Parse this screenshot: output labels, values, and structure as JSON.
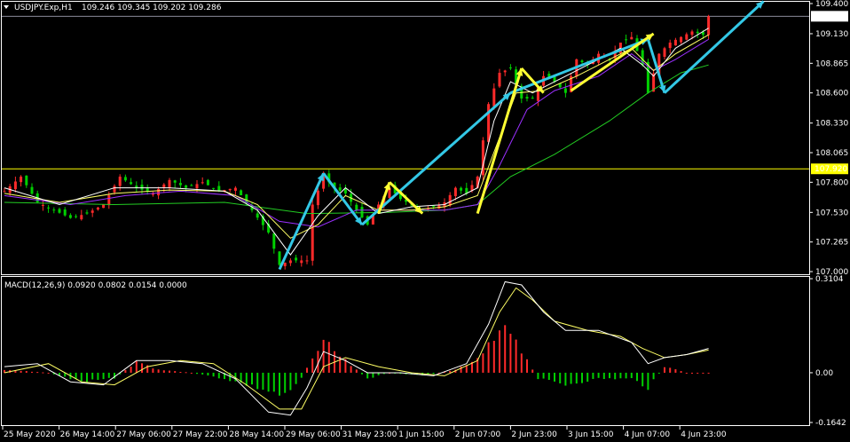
{
  "chart_data": [
    {
      "type": "candlestick",
      "title": "USDJPY.Exp,H1",
      "ohlc_label": "109.246 109.345 109.202 109.286",
      "ylim": [
        107.0,
        109.4
      ],
      "y_ticks": [
        "109.400",
        "109.130",
        "108.865",
        "108.600",
        "108.330",
        "108.065",
        "107.800",
        "107.530",
        "107.265",
        "107.000"
      ],
      "y_tick_values": [
        109.4,
        109.13,
        108.865,
        108.6,
        108.33,
        108.065,
        107.8,
        107.53,
        107.265,
        107.0
      ],
      "price_label": "109.286",
      "price_value": 109.286,
      "hline_label": "107.920",
      "hline_value": 107.92,
      "colors": {
        "up": "#ff2a2a",
        "down": "#00d000",
        "ma_fast": "#ffffff",
        "ma_mid": "#ffff66",
        "ma_slow": "#9b30ff",
        "ma_long": "#22cc22",
        "hline": "#ffff00",
        "arrow_yellow": "#ffff33",
        "arrow_cyan": "#33c8e6"
      },
      "price_path": [
        [
          0,
          107.72
        ],
        [
          3,
          107.85
        ],
        [
          6,
          107.62
        ],
        [
          9,
          107.55
        ],
        [
          12,
          107.48
        ],
        [
          15,
          107.52
        ],
        [
          18,
          107.6
        ],
        [
          21,
          107.85
        ],
        [
          24,
          107.75
        ],
        [
          27,
          107.7
        ],
        [
          30,
          107.82
        ],
        [
          33,
          107.75
        ],
        [
          36,
          107.8
        ],
        [
          39,
          107.72
        ],
        [
          42,
          107.75
        ],
        [
          45,
          107.55
        ],
        [
          48,
          107.35
        ],
        [
          50,
          107.06
        ],
        [
          52,
          107.1
        ],
        [
          55,
          107.1
        ],
        [
          56,
          107.6
        ],
        [
          58,
          107.85
        ],
        [
          60,
          107.75
        ],
        [
          62,
          107.7
        ],
        [
          64,
          107.55
        ],
        [
          66,
          107.42
        ],
        [
          68,
          107.6
        ],
        [
          70,
          107.75
        ],
        [
          72,
          107.65
        ],
        [
          74,
          107.6
        ],
        [
          76,
          107.55
        ],
        [
          78,
          107.58
        ],
        [
          80,
          107.62
        ],
        [
          82,
          107.75
        ],
        [
          84,
          107.7
        ],
        [
          86,
          107.85
        ],
        [
          88,
          108.5
        ],
        [
          90,
          108.78
        ],
        [
          92,
          108.82
        ],
        [
          94,
          108.55
        ],
        [
          96,
          108.55
        ],
        [
          98,
          108.75
        ],
        [
          100,
          108.7
        ],
        [
          102,
          108.6
        ],
        [
          104,
          108.9
        ],
        [
          106,
          108.85
        ],
        [
          108,
          108.95
        ],
        [
          110,
          108.9
        ],
        [
          112,
          109.05
        ],
        [
          114,
          109.1
        ],
        [
          116,
          108.85
        ],
        [
          117,
          108.6
        ],
        [
          119,
          108.95
        ],
        [
          121,
          109.05
        ],
        [
          123,
          109.1
        ],
        [
          125,
          109.15
        ],
        [
          127,
          109.12
        ],
        [
          128,
          109.286
        ]
      ],
      "ma_fast_path": [
        [
          0,
          107.75
        ],
        [
          10,
          107.6
        ],
        [
          20,
          107.75
        ],
        [
          30,
          107.75
        ],
        [
          40,
          107.72
        ],
        [
          46,
          107.55
        ],
        [
          52,
          107.15
        ],
        [
          57,
          107.5
        ],
        [
          62,
          107.75
        ],
        [
          68,
          107.52
        ],
        [
          74,
          107.58
        ],
        [
          80,
          107.6
        ],
        [
          86,
          107.75
        ],
        [
          89,
          108.35
        ],
        [
          92,
          108.7
        ],
        [
          96,
          108.6
        ],
        [
          100,
          108.7
        ],
        [
          106,
          108.85
        ],
        [
          112,
          109.0
        ],
        [
          116,
          108.85
        ],
        [
          118,
          108.75
        ],
        [
          122,
          109.0
        ],
        [
          128,
          109.18
        ]
      ],
      "ma_mid_path": [
        [
          0,
          107.7
        ],
        [
          10,
          107.62
        ],
        [
          20,
          107.7
        ],
        [
          30,
          107.73
        ],
        [
          40,
          107.72
        ],
        [
          46,
          107.6
        ],
        [
          52,
          107.3
        ],
        [
          57,
          107.42
        ],
        [
          62,
          107.68
        ],
        [
          68,
          107.55
        ],
        [
          74,
          107.55
        ],
        [
          80,
          107.58
        ],
        [
          86,
          107.68
        ],
        [
          90,
          108.2
        ],
        [
          93,
          108.6
        ],
        [
          98,
          108.62
        ],
        [
          104,
          108.75
        ],
        [
          110,
          108.9
        ],
        [
          114,
          109.0
        ],
        [
          118,
          108.8
        ],
        [
          122,
          108.95
        ],
        [
          128,
          109.12
        ]
      ],
      "ma_slow_path": [
        [
          0,
          107.68
        ],
        [
          12,
          107.6
        ],
        [
          22,
          107.68
        ],
        [
          32,
          107.72
        ],
        [
          42,
          107.68
        ],
        [
          50,
          107.45
        ],
        [
          57,
          107.4
        ],
        [
          64,
          107.55
        ],
        [
          72,
          107.55
        ],
        [
          80,
          107.55
        ],
        [
          86,
          107.6
        ],
        [
          90,
          107.95
        ],
        [
          95,
          108.45
        ],
        [
          100,
          108.62
        ],
        [
          108,
          108.75
        ],
        [
          114,
          108.95
        ],
        [
          118,
          108.8
        ],
        [
          122,
          108.9
        ],
        [
          128,
          109.08
        ]
      ],
      "ma_long_path": [
        [
          0,
          107.62
        ],
        [
          20,
          107.6
        ],
        [
          40,
          107.62
        ],
        [
          55,
          107.52
        ],
        [
          70,
          107.53
        ],
        [
          80,
          107.55
        ],
        [
          86,
          107.6
        ],
        [
          92,
          107.85
        ],
        [
          100,
          108.05
        ],
        [
          110,
          108.35
        ],
        [
          117,
          108.6
        ],
        [
          123,
          108.78
        ],
        [
          128,
          108.85
        ]
      ],
      "yellow_arrows": [
        [
          [
            86,
            107.52
          ],
          [
            94,
            108.82
          ]
        ],
        [
          [
            94,
            108.82
          ],
          [
            98,
            108.6
          ]
        ],
        [
          [
            103,
            108.62
          ],
          [
            118,
            109.13
          ]
        ],
        [
          [
            68,
            107.52
          ],
          [
            70,
            107.8
          ]
        ],
        [
          [
            70,
            107.8
          ],
          [
            76,
            107.52
          ]
        ]
      ],
      "cyan_arrows": [
        [
          [
            50,
            107.02
          ],
          [
            58,
            107.88
          ]
        ],
        [
          [
            58,
            107.88
          ],
          [
            65,
            107.42
          ]
        ],
        [
          [
            65,
            107.42
          ],
          [
            92,
            108.6
          ]
        ],
        [
          [
            92,
            108.6
          ],
          [
            117,
            109.08
          ]
        ],
        [
          [
            117,
            109.08
          ],
          [
            120,
            108.6
          ]
        ],
        [
          [
            120,
            108.6
          ],
          [
            138,
            109.42
          ]
        ]
      ]
    },
    {
      "type": "bar",
      "title": "MACD(12,26,9) 0.0920 0.0802 0.0154 0.0000",
      "ylim": [
        -0.1642,
        0.3104
      ],
      "y_ticks": [
        "0.3104",
        "0.00",
        "-0.1642"
      ],
      "y_tick_values": [
        0.3104,
        0.0,
        -0.1642
      ],
      "x_ticks": [
        "25 May 2020",
        "26 May 14:00",
        "27 May 06:00",
        "27 May 22:00",
        "28 May 14:00",
        "29 May 06:00",
        "31 May 23:00",
        "1 Jun 15:00",
        "2 Jun 07:00",
        "2 Jun 23:00",
        "3 Jun 15:00",
        "4 Jun 07:00",
        "4 Jun 23:00"
      ],
      "hist_path": [
        [
          0,
          0.01
        ],
        [
          8,
          0.0
        ],
        [
          14,
          -0.03
        ],
        [
          20,
          -0.02
        ],
        [
          24,
          0.04
        ],
        [
          28,
          0.01
        ],
        [
          34,
          0.0
        ],
        [
          40,
          -0.02
        ],
        [
          46,
          -0.05
        ],
        [
          51,
          -0.08
        ],
        [
          54,
          -0.02
        ],
        [
          57,
          0.09
        ],
        [
          59,
          0.1
        ],
        [
          62,
          0.04
        ],
        [
          66,
          -0.02
        ],
        [
          70,
          0.0
        ],
        [
          76,
          -0.01
        ],
        [
          82,
          0.01
        ],
        [
          86,
          0.05
        ],
        [
          89,
          0.13
        ],
        [
          91,
          0.15
        ],
        [
          94,
          0.07
        ],
        [
          97,
          -0.02
        ],
        [
          102,
          -0.04
        ],
        [
          108,
          -0.02
        ],
        [
          114,
          -0.02
        ],
        [
          117,
          -0.05
        ],
        [
          120,
          0.02
        ],
        [
          124,
          0.0
        ],
        [
          128,
          0.0
        ]
      ],
      "macd_path": [
        [
          0,
          0.02
        ],
        [
          6,
          0.03
        ],
        [
          12,
          -0.03
        ],
        [
          18,
          -0.04
        ],
        [
          24,
          0.04
        ],
        [
          30,
          0.04
        ],
        [
          36,
          0.03
        ],
        [
          42,
          -0.02
        ],
        [
          48,
          -0.13
        ],
        [
          52,
          -0.14
        ],
        [
          55,
          -0.05
        ],
        [
          58,
          0.07
        ],
        [
          62,
          0.04
        ],
        [
          66,
          0.0
        ],
        [
          72,
          0.0
        ],
        [
          78,
          -0.01
        ],
        [
          84,
          0.03
        ],
        [
          88,
          0.16
        ],
        [
          91,
          0.3
        ],
        [
          94,
          0.29
        ],
        [
          98,
          0.2
        ],
        [
          102,
          0.14
        ],
        [
          108,
          0.14
        ],
        [
          114,
          0.1
        ],
        [
          117,
          0.03
        ],
        [
          120,
          0.05
        ],
        [
          124,
          0.06
        ],
        [
          128,
          0.08
        ]
      ],
      "signal_path": [
        [
          0,
          0.0
        ],
        [
          8,
          0.03
        ],
        [
          14,
          -0.03
        ],
        [
          20,
          -0.04
        ],
        [
          26,
          0.02
        ],
        [
          32,
          0.04
        ],
        [
          38,
          0.03
        ],
        [
          44,
          -0.04
        ],
        [
          50,
          -0.12
        ],
        [
          54,
          -0.12
        ],
        [
          58,
          0.02
        ],
        [
          62,
          0.05
        ],
        [
          68,
          0.02
        ],
        [
          74,
          0.0
        ],
        [
          80,
          -0.01
        ],
        [
          86,
          0.04
        ],
        [
          90,
          0.2
        ],
        [
          93,
          0.28
        ],
        [
          96,
          0.24
        ],
        [
          100,
          0.17
        ],
        [
          106,
          0.14
        ],
        [
          112,
          0.12
        ],
        [
          116,
          0.08
        ],
        [
          120,
          0.05
        ],
        [
          124,
          0.06
        ],
        [
          128,
          0.075
        ]
      ]
    }
  ]
}
